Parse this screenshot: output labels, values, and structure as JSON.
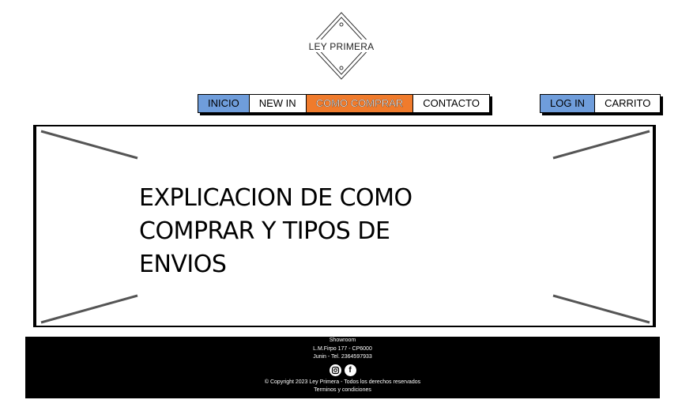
{
  "brand": {
    "logo_text": "LEY PRIMERA"
  },
  "nav": {
    "main": [
      {
        "label": "INICIO",
        "color": "#6f9ddb"
      },
      {
        "label": "NEW IN",
        "color": "#ffffff"
      },
      {
        "label": "COMO COMPRAR",
        "color": "#f07b2c"
      },
      {
        "label": "CONTACTO",
        "color": "#ffffff"
      }
    ],
    "user": [
      {
        "label": "LOG IN",
        "color": "#6f9ddb"
      },
      {
        "label": "CARRITO",
        "color": "#ffffff"
      }
    ]
  },
  "main": {
    "placeholder_text": "EXPLICACION DE COMO COMPRAR Y TIPOS DE ENVIOS"
  },
  "footer": {
    "showroom": "Showroom",
    "address": "L.M.Firpo 177 - CP6000",
    "city_phone": "Junin - Tel. 2364597933",
    "social_icons": [
      "instagram-icon",
      "facebook-icon"
    ],
    "copyright": "© Copyright 2023 Ley Primera - Todos los derechos reservados",
    "terms": "Terminos y condiciones"
  }
}
